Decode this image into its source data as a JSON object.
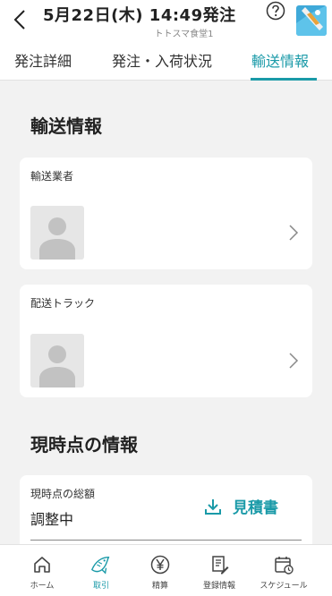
{
  "header": {
    "title": "5月22日(木) 14:49発注",
    "subtitle": "トトスマ食堂1"
  },
  "tabs": [
    {
      "label": "発注詳細",
      "active": false
    },
    {
      "label": "発注・入荷状況",
      "active": false
    },
    {
      "label": "輸送情報",
      "active": true
    }
  ],
  "transport": {
    "title": "輸送情報",
    "carrier_label": "輸送業者",
    "truck_label": "配送トラック"
  },
  "current": {
    "title": "現時点の情報",
    "total_label": "現時点の総額",
    "total_value": "調整中",
    "estimate_label": "見積書"
  },
  "nav": [
    {
      "label": "ホーム",
      "icon": "home-icon",
      "active": false
    },
    {
      "label": "取引",
      "icon": "fish-icon",
      "active": true
    },
    {
      "label": "精算",
      "icon": "yen-icon",
      "active": false
    },
    {
      "label": "登録情報",
      "icon": "edit-document-icon",
      "active": false
    },
    {
      "label": "スケジュール",
      "icon": "calendar-clock-icon",
      "active": false
    }
  ],
  "colors": {
    "accent": "#1a9aa8",
    "background": "#f2f2f2"
  }
}
